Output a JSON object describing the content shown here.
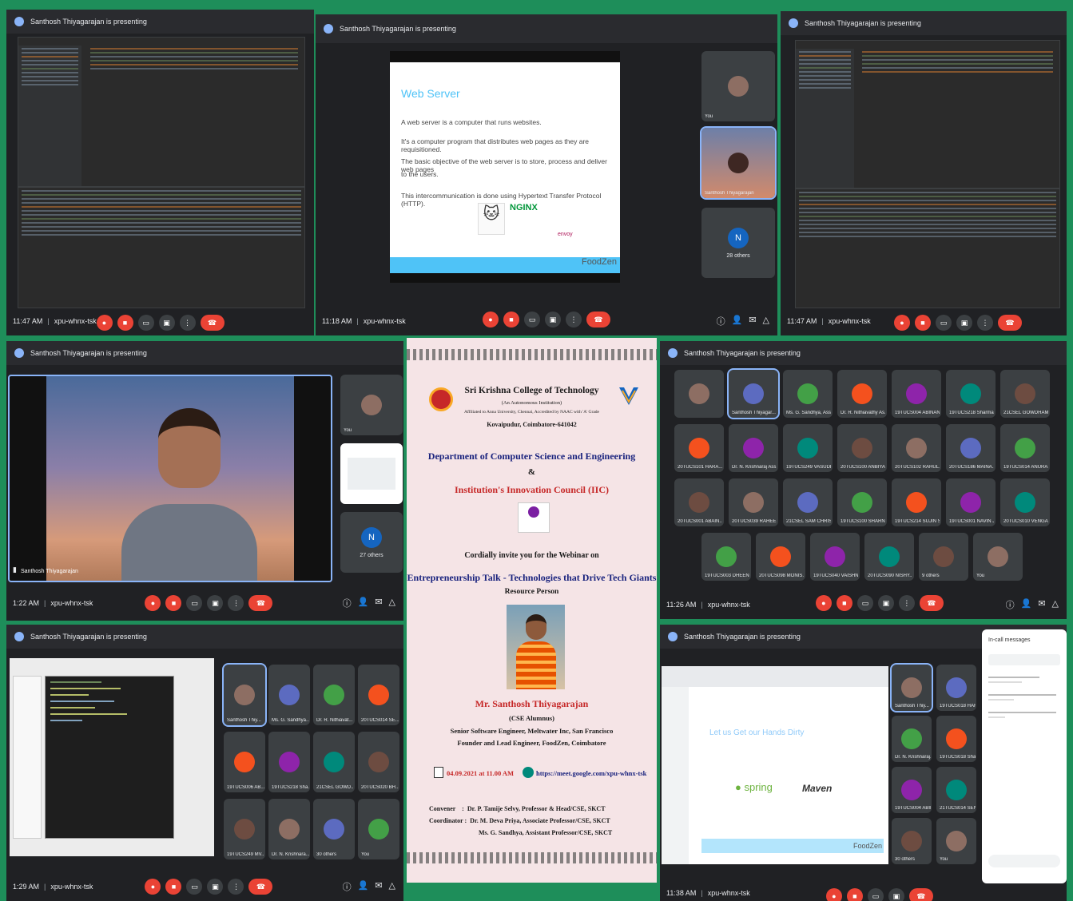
{
  "panels": {
    "p1": {
      "presenting": "Santhosh Thiyagarajan is presenting",
      "time": "11:47 AM",
      "code": "xpu-whnx-tsk"
    },
    "p2": {
      "presenting": "Santhosh Thiyagarajan is presenting",
      "time": "11:18 AM",
      "code": "xpu-whnx-tsk",
      "slide": {
        "title": "Web Server",
        "lines": [
          "A web server is a computer that runs websites.",
          "It's a computer program that distributes web pages as they are requisitioned.",
          "The basic objective of the web server is to store, process and deliver web pages",
          "to the users.",
          "This intercommunication is done using Hypertext Transfer Protocol (HTTP)."
        ],
        "logos": [
          "NGINX",
          "envoy",
          "FoodZen"
        ]
      },
      "tiles": {
        "you": "You",
        "presenter": "Santhosh Thiyagarajan",
        "others": "28 others"
      }
    },
    "p3": {
      "presenting": "Santhosh Thiyagarajan is presenting",
      "time": "11:47 AM",
      "code": "xpu-whnx-tsk"
    },
    "p4": {
      "presenting": "Santhosh Thiyagarajan is presenting",
      "time": "1:22 AM",
      "code": "xpu-whnx-tsk",
      "main_label": "Santhosh Thiyagarajan",
      "tiles": {
        "you": "You",
        "others": "27 others"
      }
    },
    "p5": {
      "presenting": "Santhosh Thiyagarajan is presenting",
      "time": "11:26 AM",
      "code": "xpu-whnx-tsk",
      "grid": [
        [
          "",
          "Santhosh Thiyagar...",
          "Ms. G. Sandhya, Ass...",
          "Dr. R. Nithiavathy As...",
          "19TUCS004 ABINAN...",
          "19TUCS218 Sharma...",
          "21CSEL GOWDHAM..."
        ],
        [
          "20TUCS101 HARA...",
          "Dr. N. Krishnaraj Ass...",
          "19TUCS249 VASUDE...",
          "20TUCS100 ANBIYA...",
          "20TUCS102 RAHUL...",
          "20TUCS186 MAINA...",
          "19TUCS014 ANURA..."
        ],
        [
          "20TUCS001 ABAIN...",
          "20TUCS039 RAHEE...",
          "21CSEL SAM CHRIST...",
          "19TUCS100 SHARN...",
          "19TUCS214 SUJIN S",
          "19TUCS001 NAVIN JV",
          "20TUCS010 VENGAT..."
        ],
        [
          "19TUCS003 DHEEN...",
          "20TUCS098 MONIS...",
          "19TUCS040 VAISHN...",
          "20TUCS090 NISHY...",
          "9 others",
          "You"
        ]
      ]
    },
    "p6": {
      "presenting": "Santhosh Thiyagarajan is presenting",
      "time": "1:29 AM",
      "code": "xpu-whnx-tsk",
      "grid": [
        [
          "Santhosh Thiy...",
          "Ms. G. Sandhya...",
          "Dr. R. Nithiavat...",
          "20TUCS014 SE..."
        ],
        [
          "19TUCS006 AB...",
          "19TUCS218 Sha...",
          "21CSEL GOWD...",
          "20TUCS020 BH..."
        ],
        [
          "19TUCS249 MV...",
          "Dr. N. Krishnara...",
          "30 others",
          "You"
        ]
      ]
    },
    "p7": {
      "presenting": "Santhosh Thiyagarajan is presenting",
      "time": "11:38 AM",
      "code": "xpu-whnx-tsk",
      "slide_title": "Let us Get our Hands Dirty",
      "logos": [
        "spring",
        "Maven",
        "FoodZen"
      ],
      "chat_title": "In-call messages",
      "tiles": [
        "Santhosh Thiy...",
        "19TUCS018 HAR...",
        "Dr. N. Krishnaraj...",
        "19TUCS018 Shar...",
        "19TUCS004 ABIN...",
        "21TUCS014 SENT...",
        "30 others",
        "You"
      ]
    }
  },
  "poster": {
    "college": "Sri Krishna College of Technology",
    "autonomous": "(An Autonomous Institution)",
    "affiliation": "Affiliated to Anna University, Chennai, Accredited by NAAC with 'A' Grade",
    "location": "Kovaipudur, Coimbatore-641042",
    "dept": "Department of Computer Science and Engineering",
    "amp": "&",
    "council": "Institution's Innovation Council (IIC)",
    "invite": "Cordially invite you for the Webinar on",
    "topic": "Entrepreneurship Talk - Technologies that Drive Tech Giants",
    "resource": "Resource Person",
    "speaker": "Mr. Santhosh Thiyagarajan",
    "alumni": "(CSE Alumnus)",
    "role1": "Senior Software Engineer, Meltwater Inc, San Francisco",
    "role2": "Founder and Lead Engineer, FoodZen, Coimbatore",
    "datetime": "04.09.2021 at 11.00 AM",
    "link": "https://meet.google.com/xpu-whnx-tsk",
    "convener": "Convener    :  Dr. P. Tamije Selvy, Professor & Head/CSE, SKCT",
    "coordinator": "Coordinator :  Dr. M. Deva Priya, Associate Professor/CSE, SKCT",
    "coordinator2": "Ms. G. Sandhya, Assistant Professor/CSE, SKCT"
  },
  "colors": {
    "frame": "#1e8e5a",
    "meet_bg": "#202124",
    "end_call": "#ea4335",
    "accent": "#8ab4f8",
    "poster_bg": "#f5e4e6",
    "poster_red": "#c62828",
    "poster_blue": "#1a237e"
  }
}
